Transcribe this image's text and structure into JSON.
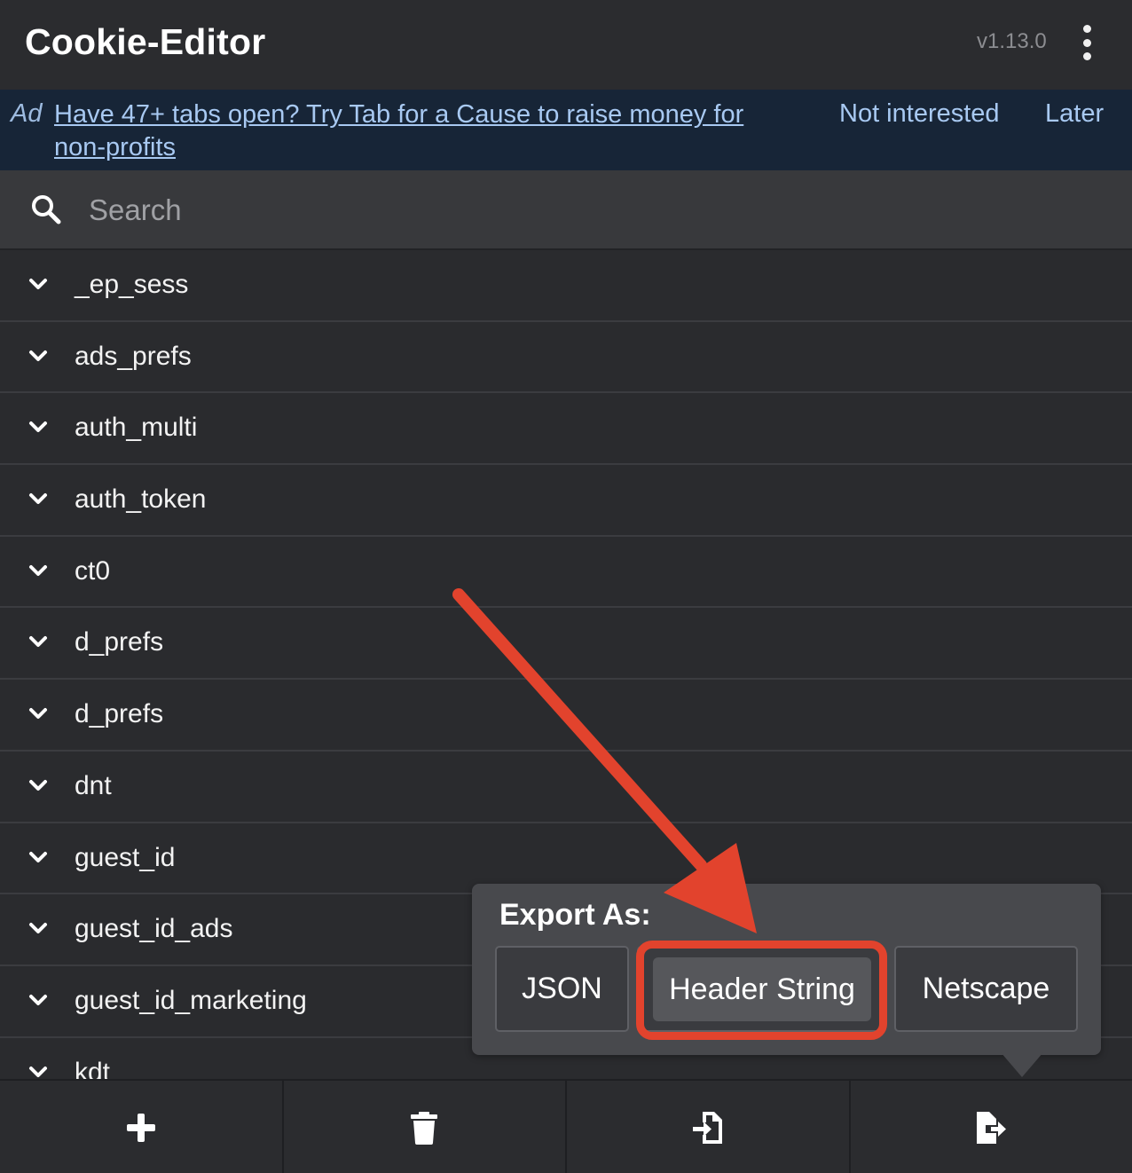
{
  "header": {
    "title": "Cookie-Editor",
    "version": "v1.13.0",
    "menu_icon": "kebab-menu-icon"
  },
  "ad": {
    "label": "Ad",
    "message": "Have 47+ tabs open? Try Tab for a Cause to raise money for non-profits",
    "not_interested_label": "Not interested",
    "later_label": "Later"
  },
  "search": {
    "placeholder": "Search",
    "value": ""
  },
  "cookies": [
    {
      "name": "_ep_sess"
    },
    {
      "name": "ads_prefs"
    },
    {
      "name": "auth_multi"
    },
    {
      "name": "auth_token"
    },
    {
      "name": "ct0"
    },
    {
      "name": "d_prefs"
    },
    {
      "name": "d_prefs"
    },
    {
      "name": "dnt"
    },
    {
      "name": "guest_id"
    },
    {
      "name": "guest_id_ads"
    },
    {
      "name": "guest_id_marketing"
    },
    {
      "name": "kdt"
    }
  ],
  "export_popover": {
    "title": "Export As:",
    "options": [
      "JSON",
      "Header String",
      "Netscape"
    ],
    "highlighted_option": "Header String"
  },
  "toolbar": {
    "items": [
      {
        "icon": "plus-icon"
      },
      {
        "icon": "trash-icon"
      },
      {
        "icon": "import-icon"
      },
      {
        "icon": "export-icon"
      }
    ]
  },
  "colors": {
    "background": "#2a2b2e",
    "ad_background": "#172537",
    "ad_link": "#a8c9f2",
    "highlight": "#e2432d",
    "popover": "#48494d"
  }
}
